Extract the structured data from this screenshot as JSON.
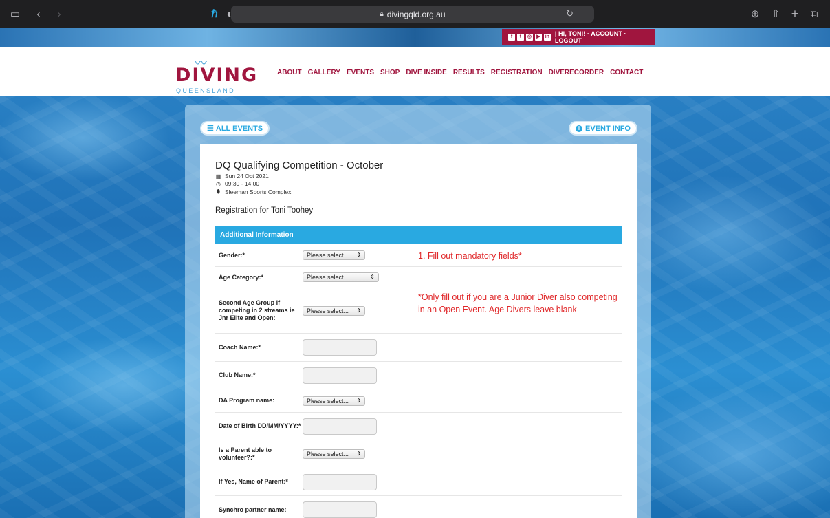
{
  "browser": {
    "url": "divingqld.org.au"
  },
  "account_bar": {
    "social": [
      "f",
      "t",
      "◎",
      "▶",
      "in"
    ],
    "text": "| HI, TONI! · ACCOUNT · LOGOUT"
  },
  "logo": {
    "main": "DIVING",
    "sub": "QUEENSLAND"
  },
  "nav": [
    "ABOUT",
    "GALLERY",
    "EVENTS",
    "SHOP",
    "DIVE INSIDE",
    "RESULTS",
    "REGISTRATION",
    "DIVERECORDER",
    "CONTACT"
  ],
  "buttons": {
    "all_events": "ALL EVENTS",
    "event_info": "EVENT INFO"
  },
  "event": {
    "title": "DQ Qualifying Competition - October",
    "date": "Sun 24 Oct 2021",
    "time": "09:30 - 14:00",
    "venue": "Sleeman Sports Complex",
    "registration_for": "Registration for Toni Toohey"
  },
  "form": {
    "header": "Additional Information",
    "select_placeholder": "Please select...",
    "fields": {
      "gender": "Gender:*",
      "age_category": "Age Category:*",
      "second_age_group": "Second Age Group if competing in 2 streams ie Jnr Elite and Open:",
      "coach_name": "Coach Name:*",
      "club_name": "Club Name:*",
      "da_program": "DA Program name:",
      "dob": "Date of Birth DD/MM/YYYY:*",
      "parent_volunteer": "Is a Parent able to volunteer?:*",
      "parent_name": "If Yes, Name of Parent:*",
      "synchro_partner": "Synchro partner name:"
    }
  },
  "annotations": {
    "note1": "1. Fill out mandatory fields*",
    "note2": "*Only fill out if you are a Junior Diver also competing in an Open Event. Age Divers leave blank"
  }
}
